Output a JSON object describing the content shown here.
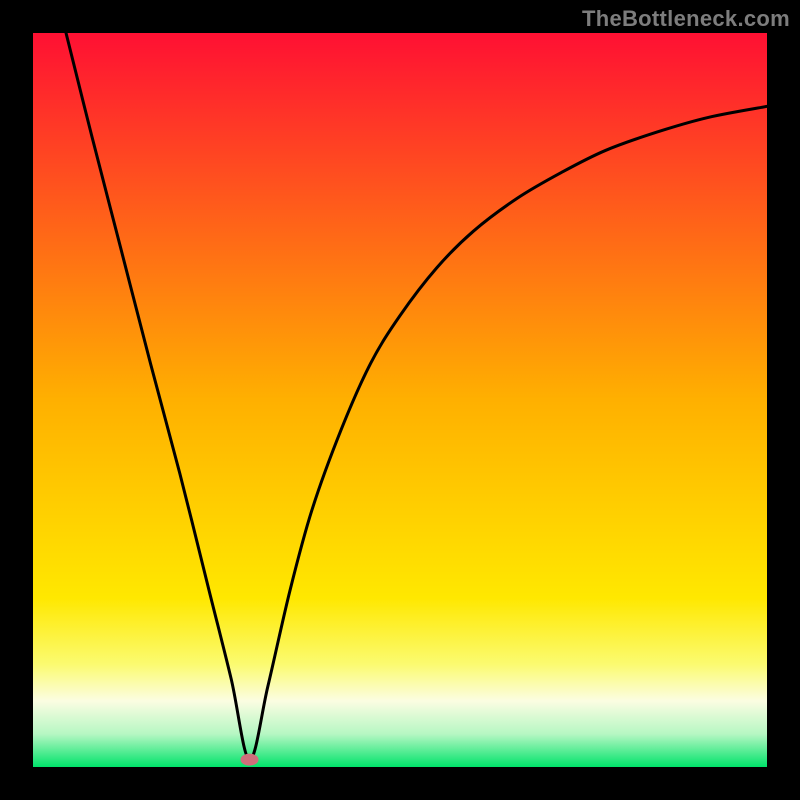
{
  "watermark": "TheBottleneck.com",
  "chart_data": {
    "type": "line",
    "title": "",
    "xlabel": "",
    "ylabel": "",
    "xlim": [
      0,
      100
    ],
    "ylim": [
      0,
      100
    ],
    "grid": false,
    "legend": false,
    "background_gradient": {
      "stops": [
        {
          "offset": 0.0,
          "color": "#ff1033"
        },
        {
          "offset": 0.5,
          "color": "#ffb000"
        },
        {
          "offset": 0.77,
          "color": "#ffe800"
        },
        {
          "offset": 0.86,
          "color": "#fbfb70"
        },
        {
          "offset": 0.91,
          "color": "#fbfde2"
        },
        {
          "offset": 0.955,
          "color": "#b6f7c3"
        },
        {
          "offset": 1.0,
          "color": "#00e36a"
        }
      ]
    },
    "marker": {
      "x": 29.5,
      "y": 1.0,
      "color": "#cf6f7b"
    },
    "series": [
      {
        "name": "curve",
        "color": "#000000",
        "x": [
          4.5,
          8,
          12,
          16,
          20,
          24,
          27,
          29.5,
          32,
          35,
          38,
          42,
          46,
          50,
          55,
          60,
          66,
          72,
          78,
          85,
          92,
          100
        ],
        "y": [
          100,
          86,
          70.5,
          55,
          40,
          24,
          12,
          1,
          11,
          24,
          35,
          46,
          55,
          61.5,
          68,
          73,
          77.5,
          81,
          84,
          86.5,
          88.5,
          90
        ]
      }
    ]
  }
}
